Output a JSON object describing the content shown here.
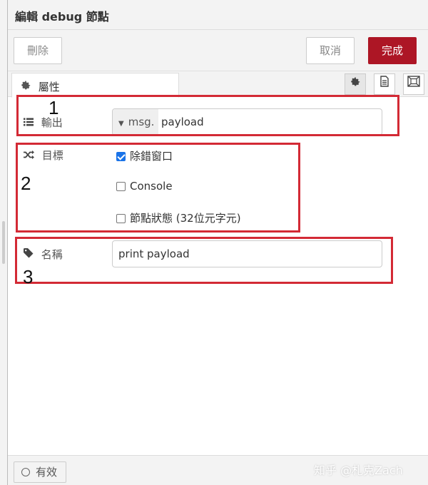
{
  "header": {
    "title": "編輯 debug 節點"
  },
  "toolbar": {
    "delete_label": "刪除",
    "cancel_label": "取消",
    "done_label": "完成"
  },
  "tabs": {
    "properties_label": "屬性"
  },
  "form": {
    "output": {
      "label": "輸出",
      "type": "msg.",
      "value": "payload"
    },
    "target": {
      "label": "目標",
      "options": [
        {
          "label": "除錯窗口",
          "checked": true
        },
        {
          "label": "Console",
          "checked": false
        },
        {
          "label": "節點狀態 (32位元字元)",
          "checked": false
        }
      ]
    },
    "name": {
      "label": "名稱",
      "value": "print payload"
    }
  },
  "annotations": [
    "1",
    "2",
    "3"
  ],
  "footer": {
    "enabled_label": "有效"
  },
  "watermark": "知乎 @札克Zach",
  "colors": {
    "primary": "#ad1625",
    "annotation": "#d32a35",
    "checkbox": "#1a73e8"
  },
  "icons": {
    "properties_tab": "gear-icon",
    "settings_tab": "gear-icon",
    "description_tab": "document-icon",
    "appearance_tab": "frame-icon",
    "output": "list-icon",
    "target": "shuffle-icon",
    "name": "tag-icon",
    "type_select": "caret-down-icon",
    "enabled": "circle-icon"
  }
}
